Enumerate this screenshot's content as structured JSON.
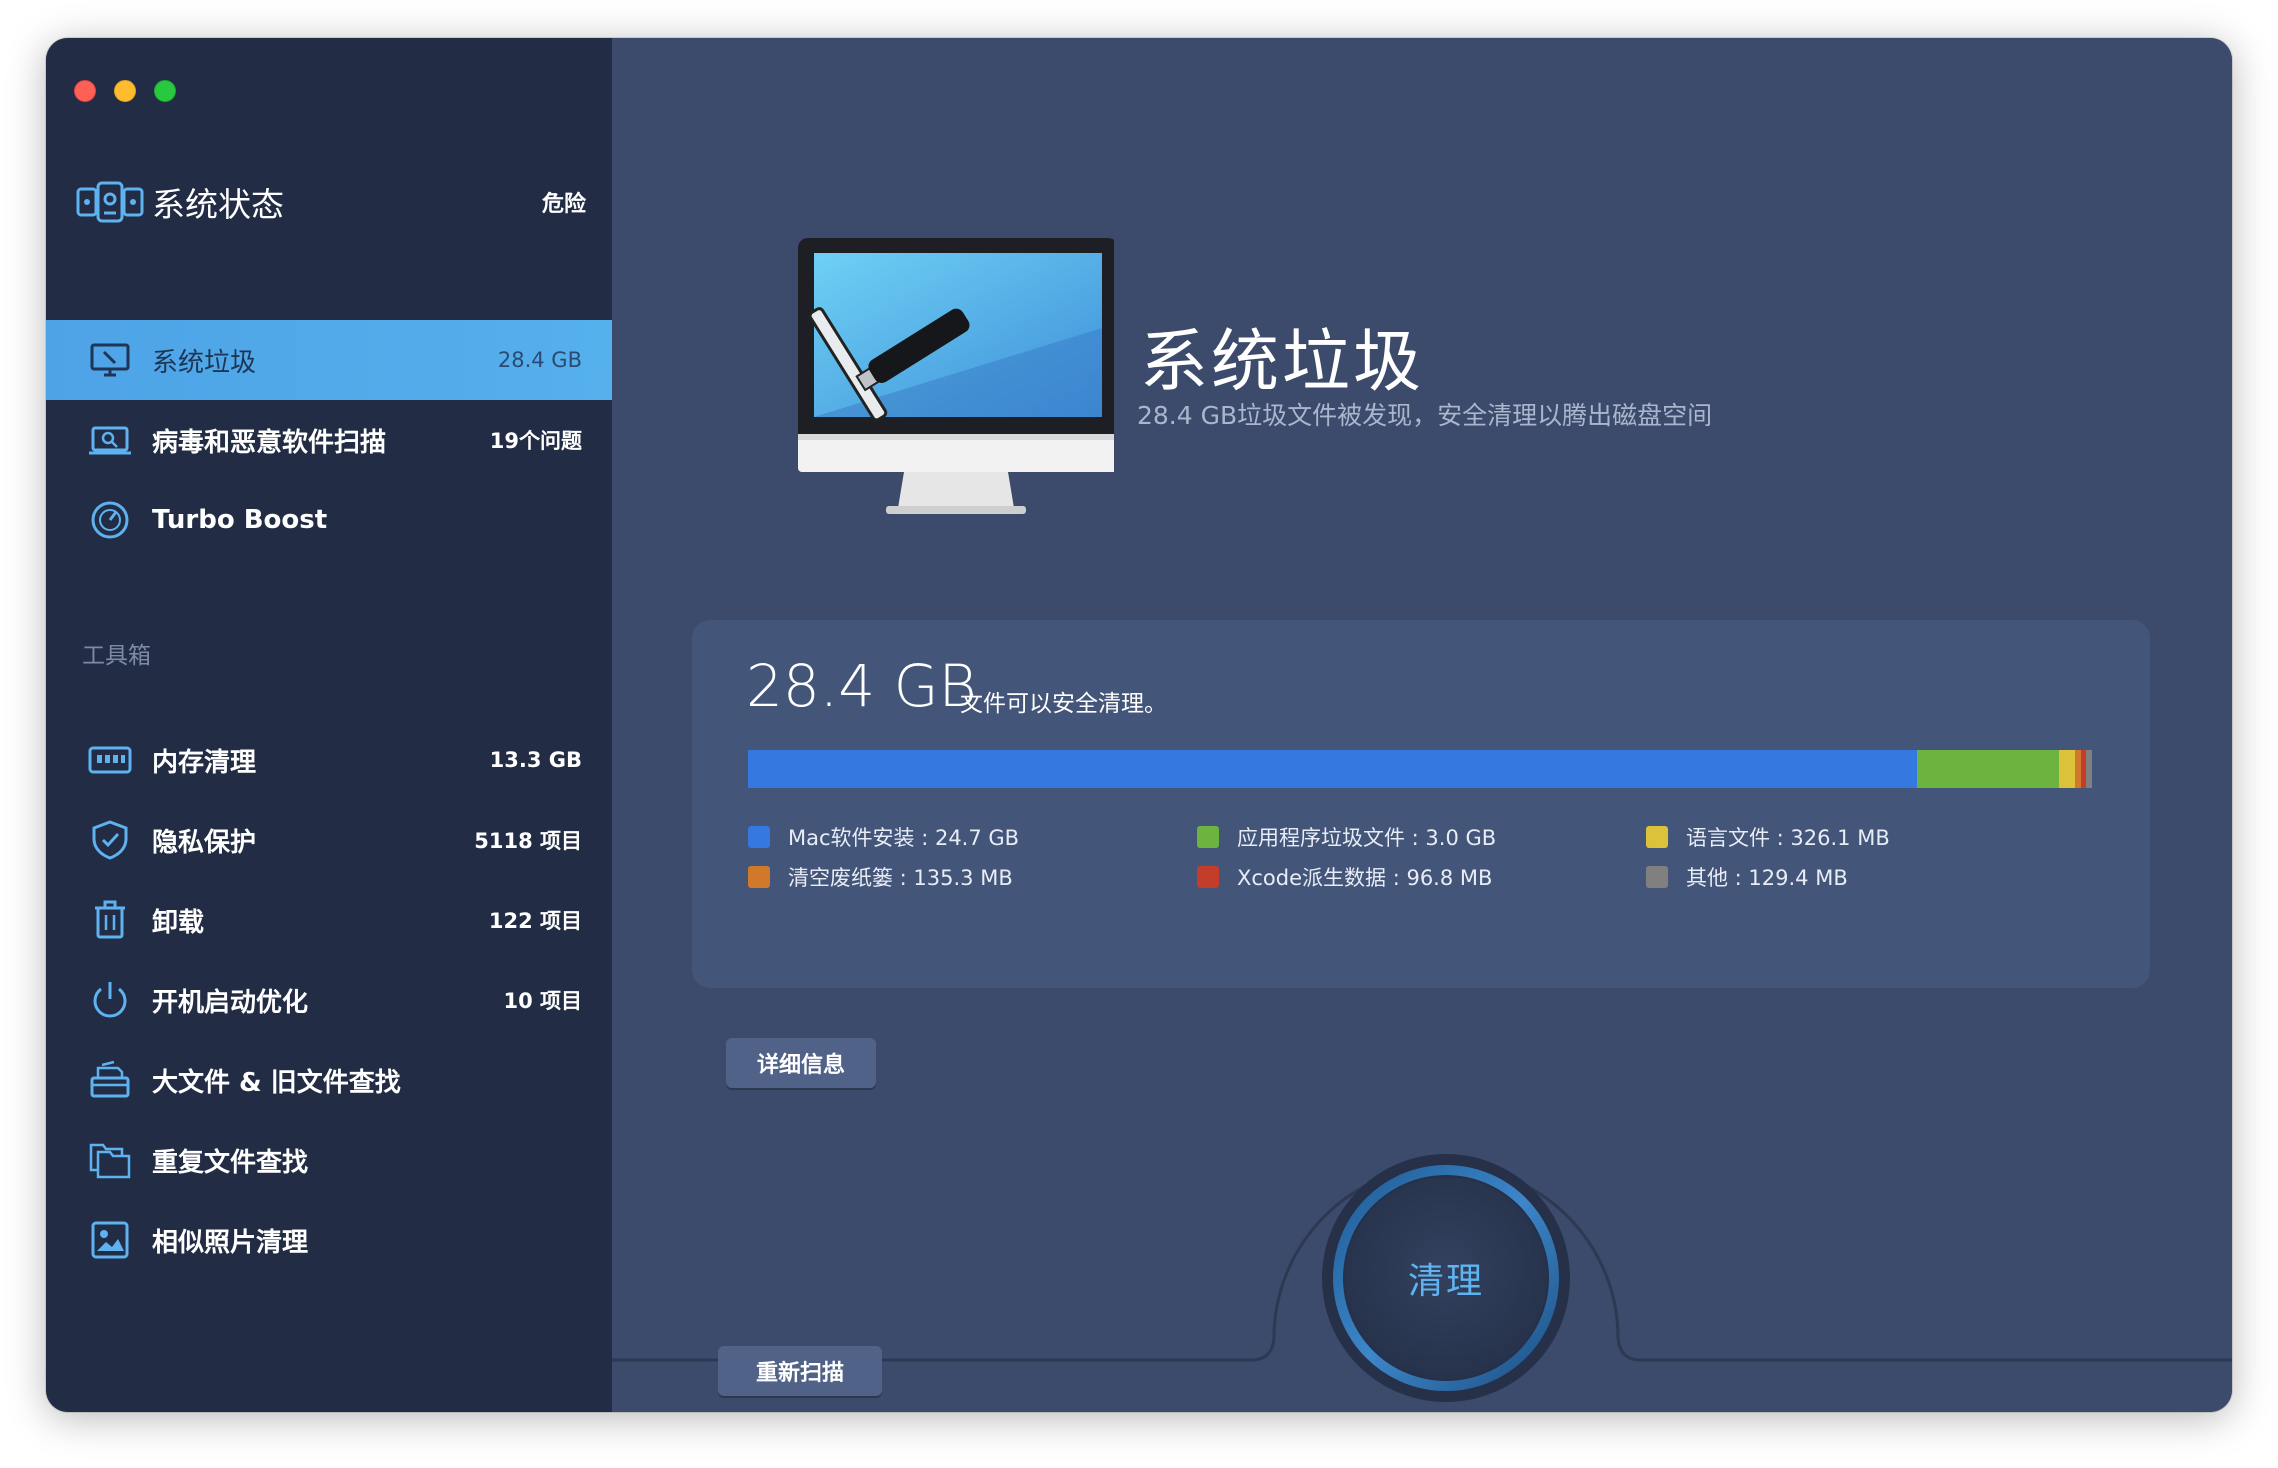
{
  "sidebar": {
    "status": {
      "title": "系统状态",
      "badge": "危险"
    },
    "items": [
      {
        "label": "系统垃圾",
        "value": "28.4 GB",
        "icon": "monitor-icon"
      },
      {
        "label": "病毒和恶意软件扫描",
        "value": "19个问题",
        "icon": "scan-icon"
      },
      {
        "label": "Turbo Boost",
        "value": "",
        "icon": "speedometer-icon"
      }
    ],
    "toolbox_label": "工具箱",
    "tools": [
      {
        "label": "内存清理",
        "value": "13.3 GB",
        "icon": "memory-icon"
      },
      {
        "label": "隐私保护",
        "value": "5118 项目",
        "icon": "shield-icon"
      },
      {
        "label": "卸载",
        "value": "122 项目",
        "icon": "trash-icon"
      },
      {
        "label": "开机启动优化",
        "value": "10 项目",
        "icon": "power-icon"
      },
      {
        "label": "大文件 & 旧文件查找",
        "value": "",
        "icon": "file-box-icon"
      },
      {
        "label": "重复文件查找",
        "value": "",
        "icon": "folders-icon"
      },
      {
        "label": "相似照片清理",
        "value": "",
        "icon": "photo-icon"
      }
    ]
  },
  "main": {
    "title": "系统垃圾",
    "subtitle": "28.4 GB垃圾文件被发现，安全清理以腾出磁盘空间",
    "summary": {
      "size": "28.4 GB",
      "label": "文件可以安全清理。"
    },
    "breakdown": [
      {
        "label": "Mac软件安装 : 24.7 GB",
        "color": "#3478e0",
        "fraction": 0.8718
      },
      {
        "label": "应用程序垃圾文件 : 3.0 GB",
        "color": "#6db33f",
        "fraction": 0.1059
      },
      {
        "label": "语言文件 : 326.1 MB",
        "color": "#dcc23a",
        "fraction": 0.0115
      },
      {
        "label": "清空废纸篓 : 135.3 MB",
        "color": "#d0792a",
        "fraction": 0.0048
      },
      {
        "label": "Xcode派生数据 : 96.8 MB",
        "color": "#c43c2a",
        "fraction": 0.0034
      },
      {
        "label": "其他 : 129.4 MB",
        "color": "#808080",
        "fraction": 0.0046
      }
    ],
    "detail_button": "详细信息",
    "clean_button": "清理",
    "rescan_button": "重新扫描"
  }
}
